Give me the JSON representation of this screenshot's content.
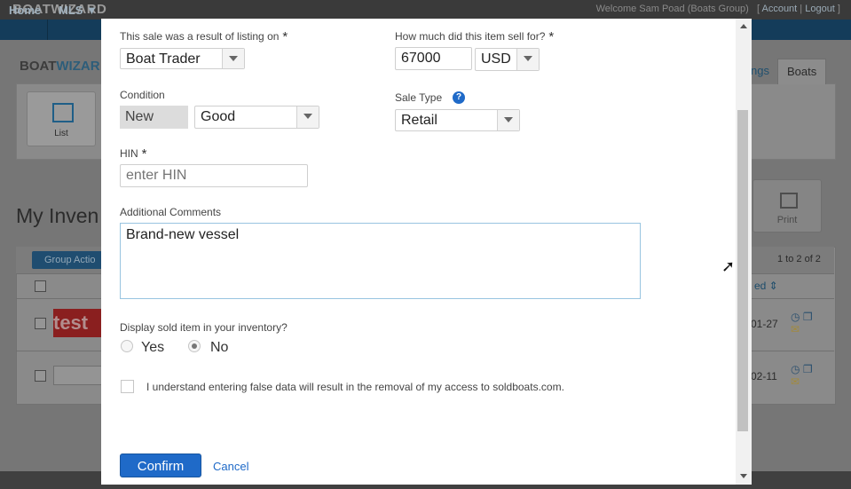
{
  "background": {
    "brand": "BOATWIZARD",
    "welcome": "Welcome Sam Poad (Boats Group)",
    "account_link": "Account",
    "logout_link": "Logout",
    "nav": {
      "home": "Home",
      "mls": "MLS ▼"
    },
    "brand2_left": "BOAT",
    "brand2_right": "WIZAR",
    "list_label": "List",
    "tab_partial": "ngs",
    "tab_boats": "Boats",
    "page_title": "My Inven",
    "print_label": "Print",
    "group_actions": "Group Actio",
    "range": "1 to 2 of 2",
    "sort_header": "ed ⇕",
    "rows": [
      {
        "date": "01-27",
        "thumb": "test"
      },
      {
        "date": "02-11"
      }
    ]
  },
  "modal": {
    "listing_label": "This sale was a result of listing on",
    "listing_value": "Boat Trader",
    "price_label": "How much did this item sell for?",
    "price_value": "67000",
    "currency_value": "USD",
    "condition_label": "Condition",
    "condition_new": "New",
    "condition_value": "Good",
    "sale_type_label": "Sale Type",
    "help_glyph": "?",
    "sale_type_value": "Retail",
    "hin_label": "HIN",
    "hin_value": "enter HIN",
    "comments_label": "Additional Comments",
    "comments_value": "Brand-new vessel",
    "display_label": "Display sold item in your inventory?",
    "radio_yes": "Yes",
    "radio_no": "No",
    "display_selected": "No",
    "agree_text": "I understand entering false data will result in the removal of my access to soldboats.com.",
    "confirm_label": "Confirm",
    "cancel_label": "Cancel",
    "required_mark": "*"
  },
  "colors": {
    "accent": "#1f6ac8",
    "overlay": "#6c6c6c"
  }
}
